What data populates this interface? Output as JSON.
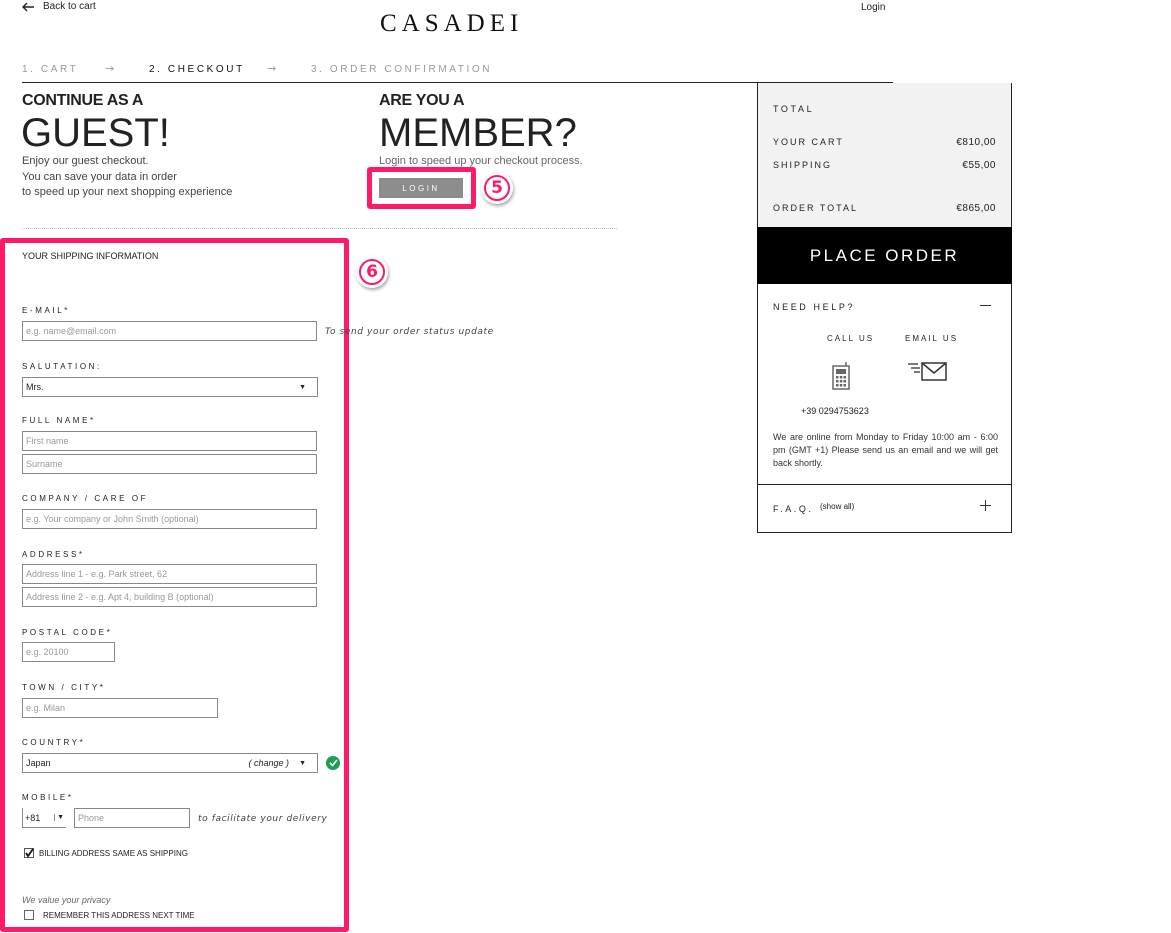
{
  "header": {
    "back_label": "Back to cart",
    "brand": "CASADEI",
    "login_label": "Login"
  },
  "steps": [
    {
      "label": "1. CART",
      "active": false
    },
    {
      "label": "2. CHECKOUT",
      "active": true
    },
    {
      "label": "3. ORDER CONFIRMATION",
      "active": false
    }
  ],
  "guest": {
    "heading_small": "CONTINUE AS A",
    "heading_big": "GUEST!",
    "line1": "Enjoy our guest checkout.",
    "line2": "You can save your data in order",
    "line3": "to speed up your next shopping experience"
  },
  "member": {
    "heading_small": "ARE YOU A",
    "heading_big": "MEMBER?",
    "line1": "Login to speed up your checkout process.",
    "login_button": "LOGIN"
  },
  "annotations": {
    "badge5": "5",
    "badge6": "6"
  },
  "form": {
    "section_title": "YOUR SHIPPING INFORMATION",
    "email_label": "E-MAIL*",
    "email_placeholder": "e.g. name@email.com",
    "email_note": "To send your order status update",
    "salutation_label": "SALUTATION:",
    "salutation_value": "Mrs.",
    "fullname_label": "FULL NAME*",
    "firstname_placeholder": "First name",
    "surname_placeholder": "Surname",
    "company_label": "COMPANY / CARE OF",
    "company_placeholder": "e.g. Your company or John Smith (optional)",
    "address_label": "ADDRESS*",
    "address1_placeholder": "Address line 1 - e.g. Park street, 62",
    "address2_placeholder": "Address line 2 - e.g. Apt 4, building B (optional)",
    "postal_label": "POSTAL CODE*",
    "postal_placeholder": "e.g. 20100",
    "town_label": "TOWN / CITY*",
    "town_placeholder": "e.g. Milan",
    "country_label": "COUNTRY*",
    "country_value": "Japan",
    "country_change": "( change )",
    "mobile_label": "MOBILE*",
    "mobile_prefix": "+81",
    "phone_placeholder": "Phone",
    "mobile_note": "to facilitate your delivery",
    "billing_label": "BILLING ADDRESS SAME AS SHIPPING",
    "privacy_note": "We value your privacy",
    "remember_label": "REMEMBER THIS ADDRESS NEXT TIME"
  },
  "summary": {
    "total_label": "TOTAL",
    "cart_label": "YOUR CART",
    "cart_value": "€810,00",
    "shipping_label": "SHIPPING",
    "shipping_value": "€55,00",
    "order_total_label": "ORDER TOTAL",
    "order_total_value": "€865,00",
    "place_order": "PLACE ORDER",
    "help_title": "NEED HELP?",
    "call_us": "CALL US",
    "email_us": "EMAIL US",
    "phone_number": "+39 0294753623",
    "help_text": "We are online from Monday to Friday 10:00 am - 6:00 pm (GMT +1) Please send us an email and we will get back shortly.",
    "faq_label": "F.A.Q.",
    "faq_show": "(show all)"
  },
  "colors": {
    "annotation": "#ff1a66",
    "black": "#000000",
    "check_green": "#1f9d55",
    "login_gray": "#8c8c8c"
  }
}
